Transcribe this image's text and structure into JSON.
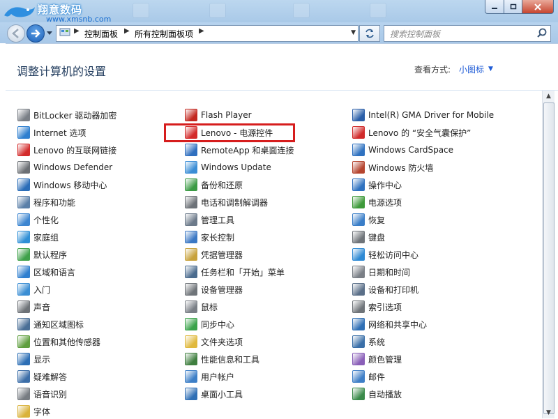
{
  "watermark": {
    "line1": "翔意数码",
    "line2": "www.xmsnb.com"
  },
  "address": {
    "crumbs": [
      "控制面板",
      "所有控制面板项"
    ]
  },
  "search": {
    "placeholder": "搜索控制面板"
  },
  "header": {
    "title": "调整计算机的设置",
    "view_by_label": "查看方式:",
    "view_by_value": "小图标"
  },
  "columns": [
    [
      {
        "label": "BitLocker 驱动器加密",
        "icon": "bitlocker-icon",
        "color": "#7a7f86"
      },
      {
        "label": "Internet 选项",
        "icon": "internet-options-icon",
        "color": "#2f7fcf"
      },
      {
        "label": "Lenovo 的互联网链接",
        "icon": "lenovo-link-icon",
        "color": "#d32b2b"
      },
      {
        "label": "Windows Defender",
        "icon": "defender-icon",
        "color": "#6b6f74"
      },
      {
        "label": "Windows 移动中心",
        "icon": "mobility-center-icon",
        "color": "#2a6db8"
      },
      {
        "label": "程序和功能",
        "icon": "programs-icon",
        "color": "#5a7fa8"
      },
      {
        "label": "个性化",
        "icon": "personalization-icon",
        "color": "#3d86d1"
      },
      {
        "label": "家庭组",
        "icon": "homegroup-icon",
        "color": "#2f8fd6"
      },
      {
        "label": "默认程序",
        "icon": "default-programs-icon",
        "color": "#3fa14a"
      },
      {
        "label": "区域和语言",
        "icon": "region-icon",
        "color": "#2f7fcf"
      },
      {
        "label": "入门",
        "icon": "getting-started-icon",
        "color": "#3a8ed4"
      },
      {
        "label": "声音",
        "icon": "sound-icon",
        "color": "#6e7378"
      },
      {
        "label": "通知区域图标",
        "icon": "notification-icon",
        "color": "#4a6f96"
      },
      {
        "label": "位置和其他传感器",
        "icon": "sensors-icon",
        "color": "#5f9f3f"
      },
      {
        "label": "显示",
        "icon": "display-icon",
        "color": "#2d6fb5"
      },
      {
        "label": "疑难解答",
        "icon": "troubleshoot-icon",
        "color": "#3c6ea8"
      },
      {
        "label": "语音识别",
        "icon": "speech-icon",
        "color": "#777c82"
      },
      {
        "label": "字体",
        "icon": "fonts-icon",
        "color": "#d9b23a"
      }
    ],
    [
      {
        "label": "Flash Player",
        "icon": "flash-icon",
        "color": "#c3271f"
      },
      {
        "label": "Lenovo - 电源控件",
        "icon": "lenovo-power-icon",
        "color": "#d42a2a"
      },
      {
        "label": "RemoteApp 和桌面连接",
        "icon": "remoteapp-icon",
        "color": "#2f6fbf"
      },
      {
        "label": "Windows Update",
        "icon": "windows-update-icon",
        "color": "#3b8ed6"
      },
      {
        "label": "备份和还原",
        "icon": "backup-icon",
        "color": "#3b9b45"
      },
      {
        "label": "电话和调制解调器",
        "icon": "phone-modem-icon",
        "color": "#6d7278"
      },
      {
        "label": "管理工具",
        "icon": "admin-tools-icon",
        "color": "#6c7a8a"
      },
      {
        "label": "家长控制",
        "icon": "parental-controls-icon",
        "color": "#3b78c4"
      },
      {
        "label": "凭据管理器",
        "icon": "credential-manager-icon",
        "color": "#c8a23c"
      },
      {
        "label": "任务栏和「开始」菜单",
        "icon": "taskbar-icon",
        "color": "#4a6b8e"
      },
      {
        "label": "设备管理器",
        "icon": "device-manager-icon",
        "color": "#6f7479"
      },
      {
        "label": "鼠标",
        "icon": "mouse-icon",
        "color": "#7a7f86"
      },
      {
        "label": "同步中心",
        "icon": "sync-center-icon",
        "color": "#3aa34a"
      },
      {
        "label": "文件夹选项",
        "icon": "folder-options-icon",
        "color": "#e0b93e"
      },
      {
        "label": "性能信息和工具",
        "icon": "performance-icon",
        "color": "#3f7f3f"
      },
      {
        "label": "用户帐户",
        "icon": "user-accounts-icon",
        "color": "#3d7fc7"
      },
      {
        "label": "桌面小工具",
        "icon": "gadgets-icon",
        "color": "#2f6fb5"
      }
    ],
    [
      {
        "label": "Intel(R) GMA Driver for Mobile",
        "icon": "intel-gma-icon",
        "color": "#2a5ea8"
      },
      {
        "label": "Lenovo 的 “安全气囊保护”",
        "icon": "airbag-icon",
        "color": "#d12b2b"
      },
      {
        "label": "Windows CardSpace",
        "icon": "cardspace-icon",
        "color": "#2f72c0"
      },
      {
        "label": "Windows 防火墙",
        "icon": "firewall-icon",
        "color": "#b5452f"
      },
      {
        "label": "操作中心",
        "icon": "action-center-icon",
        "color": "#2f72c0"
      },
      {
        "label": "电源选项",
        "icon": "power-options-icon",
        "color": "#3e9a3a"
      },
      {
        "label": "恢复",
        "icon": "recovery-icon",
        "color": "#3a7ec8"
      },
      {
        "label": "键盘",
        "icon": "keyboard-icon",
        "color": "#6f7479"
      },
      {
        "label": "轻松访问中心",
        "icon": "ease-of-access-icon",
        "color": "#2f8ad4"
      },
      {
        "label": "日期和时间",
        "icon": "date-time-icon",
        "color": "#7a7f86"
      },
      {
        "label": "设备和打印机",
        "icon": "devices-printers-icon",
        "color": "#5a6f88"
      },
      {
        "label": "索引选项",
        "icon": "indexing-icon",
        "color": "#6f7479"
      },
      {
        "label": "网络和共享中心",
        "icon": "network-icon",
        "color": "#2f6fb5"
      },
      {
        "label": "系统",
        "icon": "system-icon",
        "color": "#3a6fa8"
      },
      {
        "label": "颜色管理",
        "icon": "color-management-icon",
        "color": "#8a5fb8"
      },
      {
        "label": "邮件",
        "icon": "mail-icon",
        "color": "#3f7fc7"
      },
      {
        "label": "自动播放",
        "icon": "autoplay-icon",
        "color": "#3a8a4a"
      }
    ]
  ]
}
